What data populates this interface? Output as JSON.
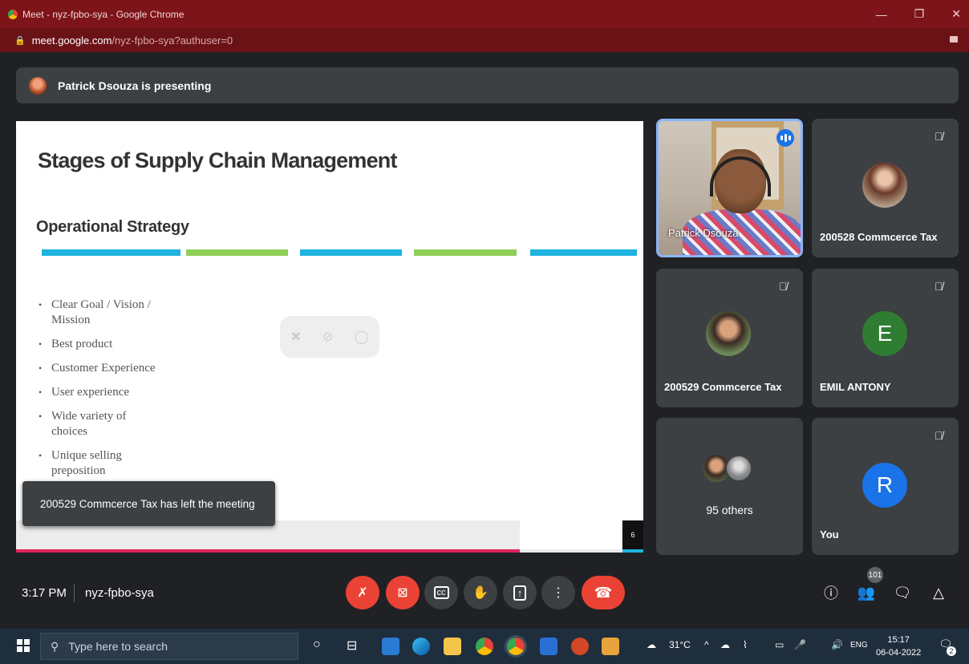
{
  "browser": {
    "window_title": "Meet - nyz-fpbo-sya - Google Chrome",
    "url_host": "meet.google.com",
    "url_path": "/nyz-fpbo-sya?authuser=0",
    "controls": {
      "minimize": "—",
      "restore": "❐",
      "close": "✕"
    }
  },
  "meet": {
    "presenting_banner": "Patrick Dsouza is presenting",
    "slide": {
      "title": "Stages of Supply Chain Management",
      "subtitle": "Operational Strategy",
      "bullets": [
        "Clear Goal / Vision / Mission",
        "Best product",
        "Customer Experience",
        "User experience",
        "Wide variety of choices",
        "Unique selling preposition"
      ],
      "page_number": "6",
      "bar_colors": [
        "#1fb3e0",
        "#8fcf5a",
        "#1fb3e0",
        "#8fcf5a",
        "#1fb3e0"
      ]
    },
    "toast": "200529 Commcerce Tax has left the meeting",
    "participants": [
      {
        "name": "Patrick Dsouza",
        "type": "video",
        "speaking": true
      },
      {
        "name": "200528 Commcerce Tax",
        "type": "photo",
        "muted": true
      },
      {
        "name": "200529 Commcerce Tax",
        "type": "photo",
        "muted": true
      },
      {
        "name": "EMIL ANTONY",
        "type": "letter",
        "letter": "E",
        "color": "#2e7d32",
        "muted": true
      },
      {
        "name": "95 others",
        "type": "group"
      },
      {
        "name": "You",
        "type": "letter",
        "letter": "R",
        "color": "#1a73e8",
        "muted": true
      }
    ],
    "bottom_bar": {
      "time": "3:17 PM",
      "meeting_code": "nyz-fpbo-sya",
      "people_count": "101"
    }
  },
  "taskbar": {
    "search_placeholder": "Type here to search",
    "weather": "31°C",
    "language": "ENG",
    "clock_time": "15:17",
    "clock_date": "06-04-2022",
    "notification_count": "2"
  },
  "colors": {
    "chrome_titlebar": "#7d1419",
    "meet_bg": "#202124",
    "tile_bg": "#3c4043",
    "danger_red": "#ea4335",
    "accent_blue": "#8ab4f8"
  }
}
